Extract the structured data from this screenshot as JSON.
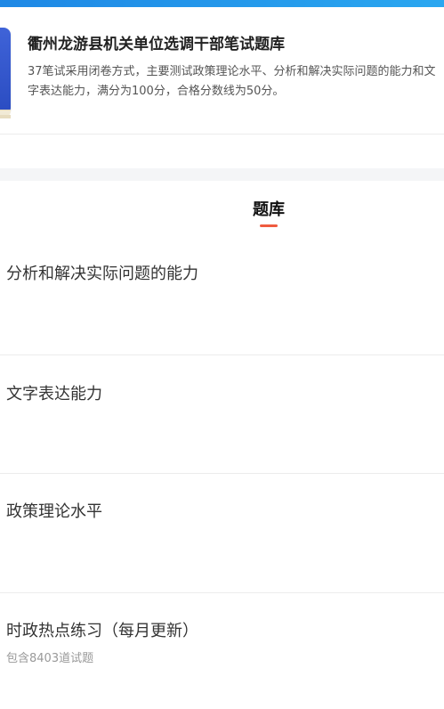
{
  "course": {
    "title": "衢州龙游县机关单位选调干部笔试题库",
    "description": "37笔试采用闭卷方式，主要测试政策理论水平、分析和解决实际问题的能力和文字表达能力，满分为100分，合格分数线为50分。",
    "cover_icon": "book-cover-icon"
  },
  "section": {
    "title": "题库",
    "accent_color": "#ef5b3f"
  },
  "question_bank": [
    {
      "label": "分析和解决实际问题的能力",
      "count_text": ""
    },
    {
      "label": "文字表达能力",
      "count_text": ""
    },
    {
      "label": "政策理论水平",
      "count_text": ""
    },
    {
      "label": "时政热点练习（每月更新）",
      "count_text": "包含8403道试题"
    }
  ],
  "colors": {
    "brand_blue": "#1e88e5",
    "text_primary": "#333333",
    "text_muted": "#999999"
  }
}
